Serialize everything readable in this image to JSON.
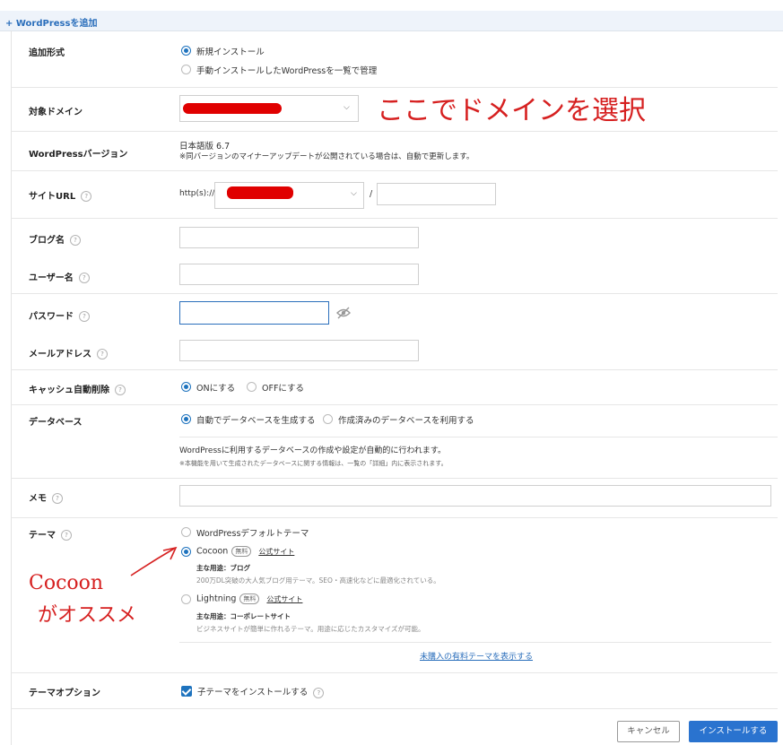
{
  "header": {
    "title": "+ WordPressを追加"
  },
  "form": {
    "add_type": {
      "label": "追加形式",
      "opt1": "新規インストール",
      "opt2": "手動インストールしたWordPressを一覧で管理"
    },
    "domain": {
      "label": "対象ドメイン"
    },
    "version": {
      "label": "WordPressバージョン",
      "value": "日本語版 6.7",
      "note": "※同バージョンのマイナーアップデートが公開されている場合は、自動で更新します。"
    },
    "site_url": {
      "label": "サイトURL",
      "prefix": "http(s)://",
      "slash": "/"
    },
    "blog_name": {
      "label": "ブログ名"
    },
    "user_name": {
      "label": "ユーザー名"
    },
    "password": {
      "label": "パスワード"
    },
    "email": {
      "label": "メールアドレス"
    },
    "cache": {
      "label": "キャッシュ自動削除",
      "on": "ONにする",
      "off": "OFFにする"
    },
    "database": {
      "label": "データベース",
      "opt1": "自動でデータベースを生成する",
      "opt2": "作成済みのデータベースを利用する",
      "desc": "WordPressに利用するデータベースの作成や設定が自動的に行われます。",
      "note": "※本機能を用いて生成されたデータベースに関する情報は、一覧の「詳細」内に表示されます。"
    },
    "memo": {
      "label": "メモ"
    },
    "theme": {
      "label": "テーマ",
      "default": "WordPressデフォルトテーマ",
      "cocoon": {
        "name": "Cocoon",
        "badge": "無料",
        "link": "公式サイト",
        "use": "主な用途：ブログ",
        "desc": "200万DL突破の大人気ブログ用テーマ。SEO・高速化などに最適化されている。"
      },
      "lightning": {
        "name": "Lightning",
        "badge": "無料",
        "link": "公式サイト",
        "use": "主な用途：コーポレートサイト",
        "desc": "ビジネスサイトが簡単に作れるテーマ。用途に応じたカスタマイズが可能。"
      },
      "paid_link": "未購入の有料テーマを表示する"
    },
    "theme_option": {
      "label": "テーマオプション",
      "child": "子テーマをインストールする"
    }
  },
  "buttons": {
    "cancel": "キャンセル",
    "install": "インストールする"
  },
  "annotations": {
    "domain_note": "ここでドメインを選択",
    "cocoon_note_1": "Cocoon",
    "cocoon_note_2": "がオススメ"
  },
  "colors": {
    "accent": "#1e73be",
    "primary_button": "#2a73cf",
    "annotation": "#d62020"
  }
}
